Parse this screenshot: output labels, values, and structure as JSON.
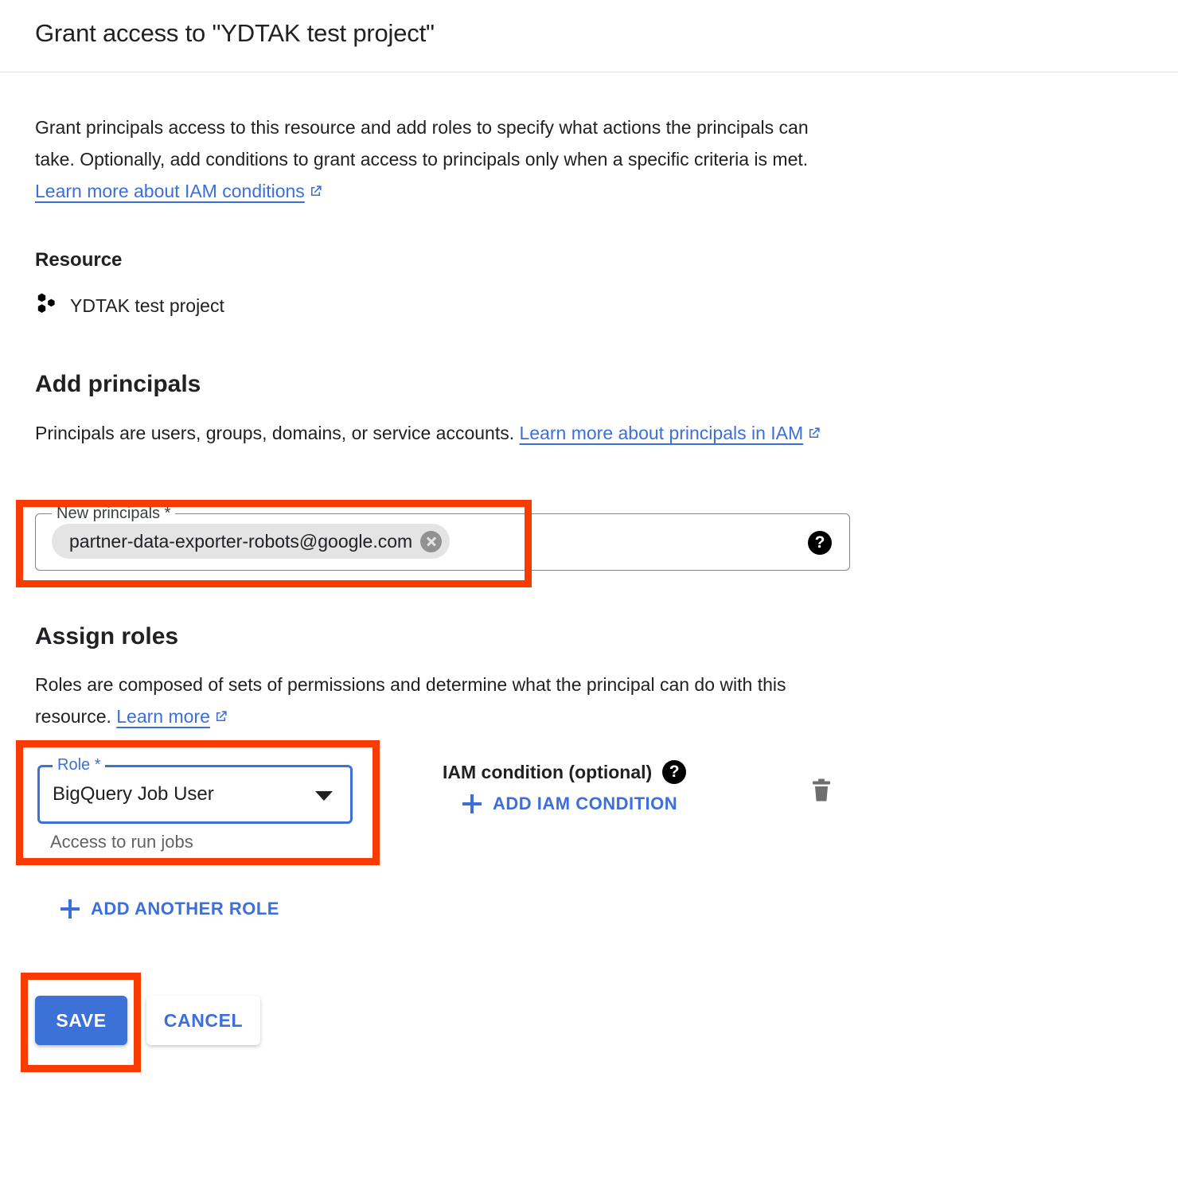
{
  "dialog": {
    "title": "Grant access to \"YDTAK test project\"",
    "intro_text_1": "Grant principals access to this resource and add roles to specify what actions the principals can take. Optionally, add conditions to grant access to principals only when a specific criteria is met. ",
    "intro_link": "Learn more about IAM conditions"
  },
  "resource": {
    "heading": "Resource",
    "name": "YDTAK test project",
    "icon": "project-hexagons-icon"
  },
  "add_principals": {
    "heading": "Add principals",
    "description": "Principals are users, groups, domains, or service accounts. ",
    "link": "Learn more about principals in IAM",
    "field_label": "New principals *",
    "chips": [
      {
        "label": "partner-data-exporter-robots@google.com",
        "remove_icon": "close-circle-icon"
      }
    ],
    "help_icon": "help-icon",
    "help_glyph": "?"
  },
  "assign_roles": {
    "heading": "Assign roles",
    "description": "Roles are composed of sets of permissions and determine what the principal can do with this resource. ",
    "link": "Learn more",
    "role_field_label": "Role *",
    "role_value": "BigQuery Job User",
    "role_hint": "Access to run jobs",
    "dropdown_icon": "chevron-down-icon",
    "iam_condition_label": "IAM condition (optional)",
    "iam_help_glyph": "?",
    "add_iam_condition": "ADD IAM CONDITION",
    "delete_icon": "trash-icon",
    "add_another_role": "ADD ANOTHER ROLE"
  },
  "actions": {
    "save": "SAVE",
    "cancel": "CANCEL"
  },
  "colors": {
    "accent_blue": "#3c72d8",
    "link_blue": "#3c6fdb",
    "highlight_red": "#fa3b00",
    "chip_gray": "#e4e4e4",
    "hint_gray": "#5f6368"
  },
  "annotations": {
    "highlight_boxes": [
      "new-principals-field",
      "role-field",
      "save-button"
    ]
  }
}
